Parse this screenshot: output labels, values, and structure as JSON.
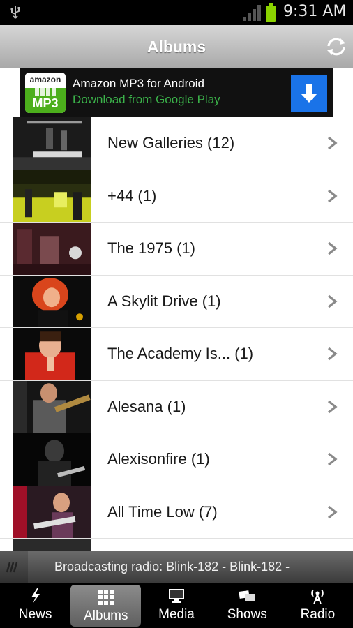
{
  "status_bar": {
    "time": "9:31 AM"
  },
  "header": {
    "title": "Albums"
  },
  "ad": {
    "logo_top": "amazon",
    "logo_bottom": "MP3",
    "title": "Amazon MP3 for Android",
    "subtitle": "Download from Google Play"
  },
  "albums": [
    {
      "label": "New Galleries (12)",
      "thumb": "crowd-stage"
    },
    {
      "label": "+44 (1)",
      "thumb": "yellow-stage"
    },
    {
      "label": "The 1975 (1)",
      "thumb": "band-dark-red"
    },
    {
      "label": "A Skylit Drive (1)",
      "thumb": "singer-red"
    },
    {
      "label": "The Academy Is... (1)",
      "thumb": "singer-red-shirt"
    },
    {
      "label": "Alesana (1)",
      "thumb": "guitarist"
    },
    {
      "label": "Alexisonfire (1)",
      "thumb": "singer-dark"
    },
    {
      "label": "All Time Low (7)",
      "thumb": "guitarist-stage"
    }
  ],
  "ticker": {
    "text": "Broadcasting radio: Blink-182 - Blink-182 - "
  },
  "nav": {
    "items": [
      {
        "label": "News",
        "icon": "lightning-icon"
      },
      {
        "label": "Albums",
        "icon": "grid-icon"
      },
      {
        "label": "Media",
        "icon": "monitor-icon"
      },
      {
        "label": "Shows",
        "icon": "tickets-icon"
      },
      {
        "label": "Radio",
        "icon": "antenna-icon"
      }
    ],
    "active_index": 1
  },
  "colors": {
    "ad_subtitle": "#3bb34a",
    "download_button": "#1a73e8",
    "mp3_green": "#4caf1c"
  }
}
